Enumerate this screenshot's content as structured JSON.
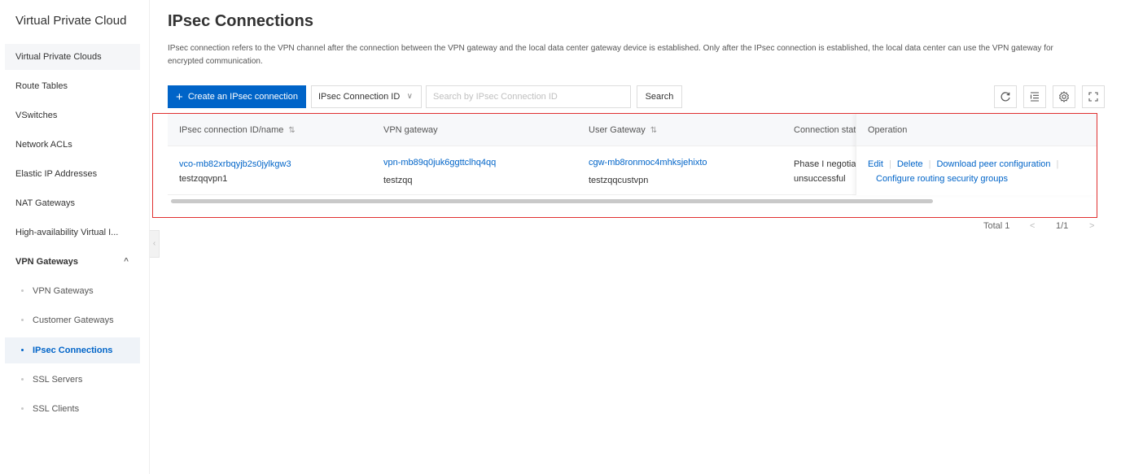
{
  "sidebar": {
    "title": "Virtual Private Cloud",
    "items": [
      {
        "label": "Virtual Private Clouds"
      },
      {
        "label": "Route Tables"
      },
      {
        "label": "VSwitches"
      },
      {
        "label": "Network ACLs"
      },
      {
        "label": "Elastic IP Addresses"
      },
      {
        "label": "NAT Gateways"
      },
      {
        "label": "High-availability Virtual I..."
      },
      {
        "label": "VPN Gateways",
        "expanded": true
      },
      {
        "label": "VPN Gateways"
      },
      {
        "label": "Customer Gateways"
      },
      {
        "label": "IPsec Connections",
        "active": true
      },
      {
        "label": "SSL Servers"
      },
      {
        "label": "SSL Clients"
      }
    ]
  },
  "page": {
    "title": "IPsec Connections",
    "description": "IPsec connection refers to the VPN channel after the connection between the VPN gateway and the local data center gateway device is established. Only after the IPsec connection is established, the local data center can use the VPN gateway for encrypted communication."
  },
  "toolbar": {
    "create_label": "Create an IPsec connection",
    "filter_select": "IPsec Connection ID",
    "search_placeholder": "Search by IPsec Connection ID",
    "search_label": "Search"
  },
  "table": {
    "headers": {
      "id_name": "IPsec connection ID/name",
      "vpn_gateway": "VPN gateway",
      "user_gateway": "User Gateway",
      "status": "Connection stat",
      "operation": "Operation"
    },
    "rows": [
      {
        "id": "vco-mb82xrbqyjb2s0jylkgw3",
        "name": "testzqqvpn1",
        "vpn_gateway_id": "vpn-mb89q0juk6ggttclhq4qq",
        "vpn_gateway_name": "testzqq",
        "user_gateway_id": "cgw-mb8ronmoc4mhksjehixto",
        "user_gateway_name": "testzqqcustvpn",
        "status_line1": "Phase I negotiat",
        "status_line2": "unsuccessful",
        "actions": {
          "edit": "Edit",
          "delete": "Delete",
          "download": "Download peer configuration",
          "routing": "Configure routing security groups"
        }
      }
    ]
  },
  "pagination": {
    "total": "Total 1",
    "page": "1/1"
  },
  "colors": {
    "primary": "#0064c8",
    "highlight_border": "#e03030"
  }
}
